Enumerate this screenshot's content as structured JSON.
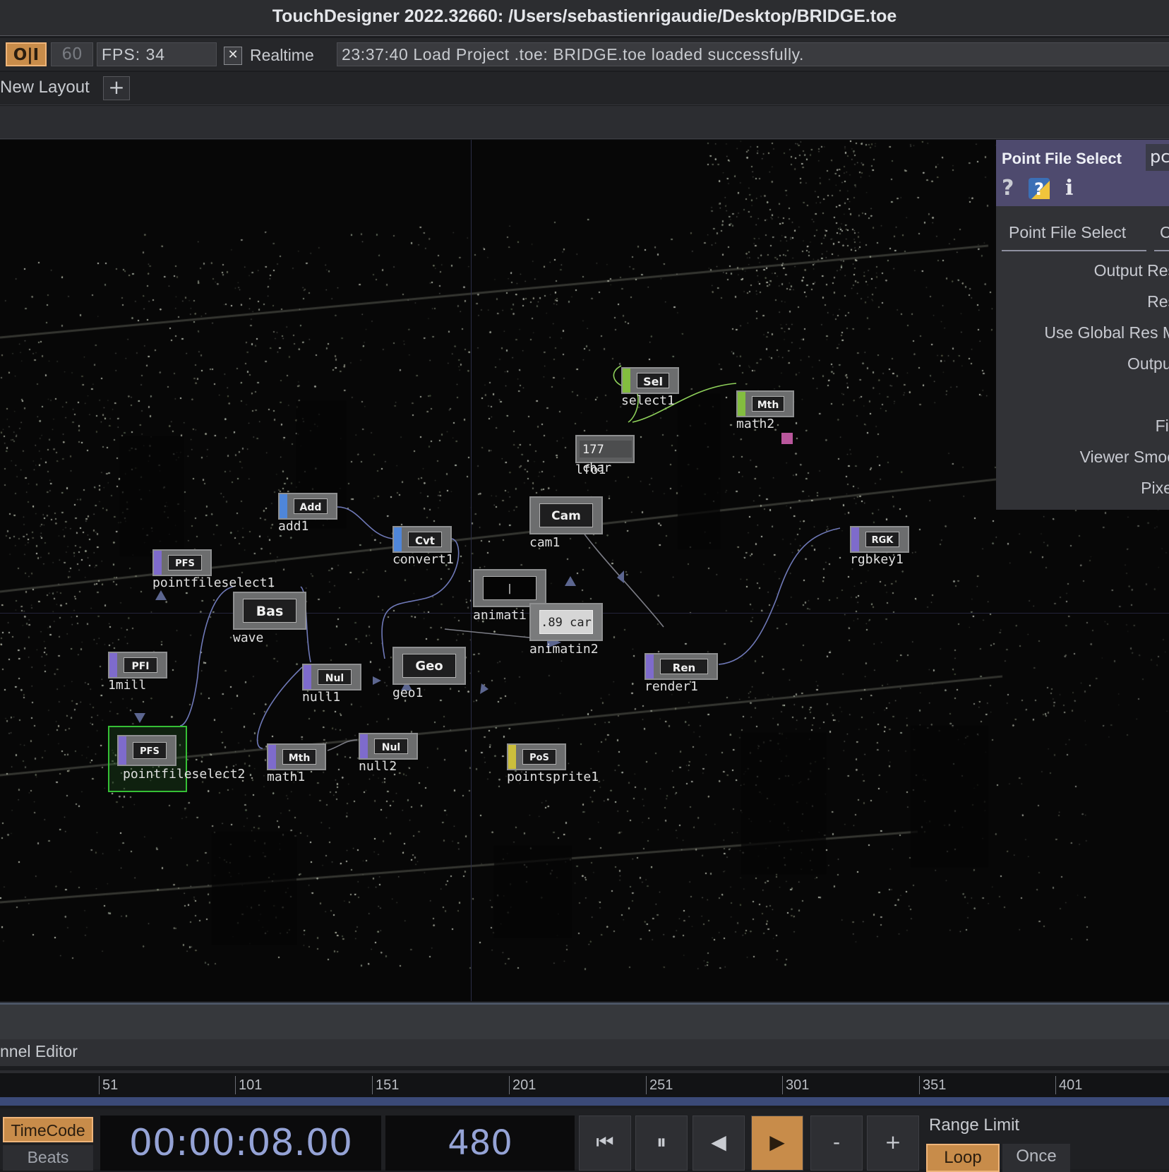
{
  "window": {
    "title": "TouchDesigner 2022.32660: /Users/sebastienrigaudie/Desktop/BRIDGE.toe"
  },
  "toolbar": {
    "oi_label": "O|I",
    "fps_cap": "60",
    "fps_label": "FPS:  34",
    "realtime_check": "✕",
    "realtime_label": "Realtime",
    "log_message": "23:37:40 Load Project .toe: BRIDGE.toe loaded successfully."
  },
  "layout": {
    "name": "New Layout",
    "add_label": "+"
  },
  "network": {
    "nodes": [
      {
        "id": "select1",
        "tag": "Sel",
        "label": "select1",
        "family": "chop"
      },
      {
        "id": "math2",
        "tag": "Mth",
        "label": "math2",
        "family": "chop"
      },
      {
        "id": "lfo1",
        "tag": "177 char",
        "label": "lfo1",
        "family": "chop"
      },
      {
        "id": "add1",
        "tag": "Add",
        "label": "add1",
        "family": "sop"
      },
      {
        "id": "convert1",
        "tag": "Cvt",
        "label": "convert1",
        "family": "sop"
      },
      {
        "id": "cam1",
        "tag": "Cam",
        "label": "cam1",
        "family": "comp"
      },
      {
        "id": "rgbkey1",
        "tag": "RGK",
        "label": "rgbkey1",
        "family": "top"
      },
      {
        "id": "pointfileselect1",
        "tag": "PFS",
        "label": "pointfileselect1",
        "family": "top"
      },
      {
        "id": "wave",
        "tag": "Bas",
        "label": "wave",
        "family": "comp"
      },
      {
        "id": "animation1",
        "tag": "|",
        "label": "animati",
        "family": "comp"
      },
      {
        "id": "animation2",
        "tag": ".89 car",
        "label": "animati",
        "label_suffix": "n2",
        "family": "comp"
      },
      {
        "id": "1mill",
        "tag": "PFI",
        "label": "1mill",
        "family": "top"
      },
      {
        "id": "null1",
        "tag": "Nul",
        "label": "null1",
        "family": "top"
      },
      {
        "id": "geo1",
        "tag": "Geo",
        "label": "geo1",
        "family": "comp"
      },
      {
        "id": "render1",
        "tag": "Ren",
        "label": "render1",
        "family": "top"
      },
      {
        "id": "pointfileselect2",
        "tag": "PFS",
        "label": "pointfileselect2",
        "family": "top"
      },
      {
        "id": "math1",
        "tag": "Mth",
        "label": "math1",
        "family": "top"
      },
      {
        "id": "null2",
        "tag": "Nul",
        "label": "null2",
        "family": "top"
      },
      {
        "id": "pointsprite1",
        "tag": "PoS",
        "label": "pointsprite1",
        "family": "mat"
      }
    ]
  },
  "param_panel": {
    "title": "Point File Select",
    "name_field": "pc",
    "help_icon": "?",
    "info_icon": "i",
    "tab": "Point File Select",
    "tab2": "C",
    "params": [
      "Output Res",
      "Res",
      "Use Global Res M",
      "Output",
      "Fill",
      "Viewer Smoo",
      "Pixel"
    ]
  },
  "channel_editor": {
    "label": "nnel Editor"
  },
  "timeline": {
    "ticks": [
      "51",
      "101",
      "151",
      "201",
      "251",
      "301",
      "351",
      "401"
    ]
  },
  "transport": {
    "timecode_label": "TimeCode",
    "beats_label": "Beats",
    "time": "00:00:08.00",
    "frame": "480",
    "rewind_label": "⏮",
    "pause_label": "⏸",
    "step_back_label": "◀",
    "play_label": "▶",
    "minus_label": "-",
    "plus_label": "+",
    "range_limit_label": "Range Limit",
    "loop_label": "Loop",
    "once_label": "Once"
  },
  "colors": {
    "accent_orange": "#c88c4a",
    "panel_header": "#4e4a6e",
    "top_family": "#7e6bcc",
    "chop_family": "#83bd3f",
    "sop_family": "#4f86d9",
    "mat_family": "#cbbe3c",
    "selected_outline": "#35c035"
  }
}
